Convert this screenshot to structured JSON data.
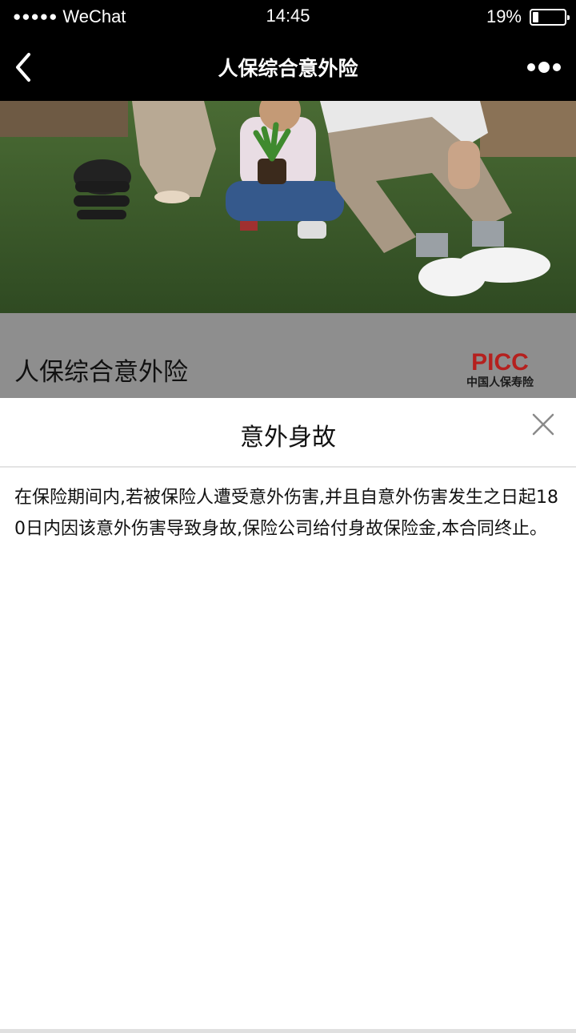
{
  "status_bar": {
    "signal_dots": "●●●●●",
    "carrier": "WeChat",
    "time": "14:45",
    "battery_percent": "19%",
    "battery_level": 0.19
  },
  "nav": {
    "back_icon": "chevron-left-icon",
    "title": "人保综合意外险",
    "more_icon": "more-dots-icon"
  },
  "banner": {
    "title": "人保综合意外险",
    "logo_text": "PICC",
    "logo_subtext": "中国人保寿险"
  },
  "modal": {
    "title": "意外身故",
    "close_icon": "close-icon",
    "body": "在保险期间内,若被保险人遭受意外伤害,并且自意外伤害发生之日起180日内因该意外伤害导致身故,保险公司给付身故保险金,本合同终止。"
  },
  "colors": {
    "bar_background": "#000000",
    "banner_background": "#8e8e8e",
    "logo_red": "#b5201e"
  }
}
